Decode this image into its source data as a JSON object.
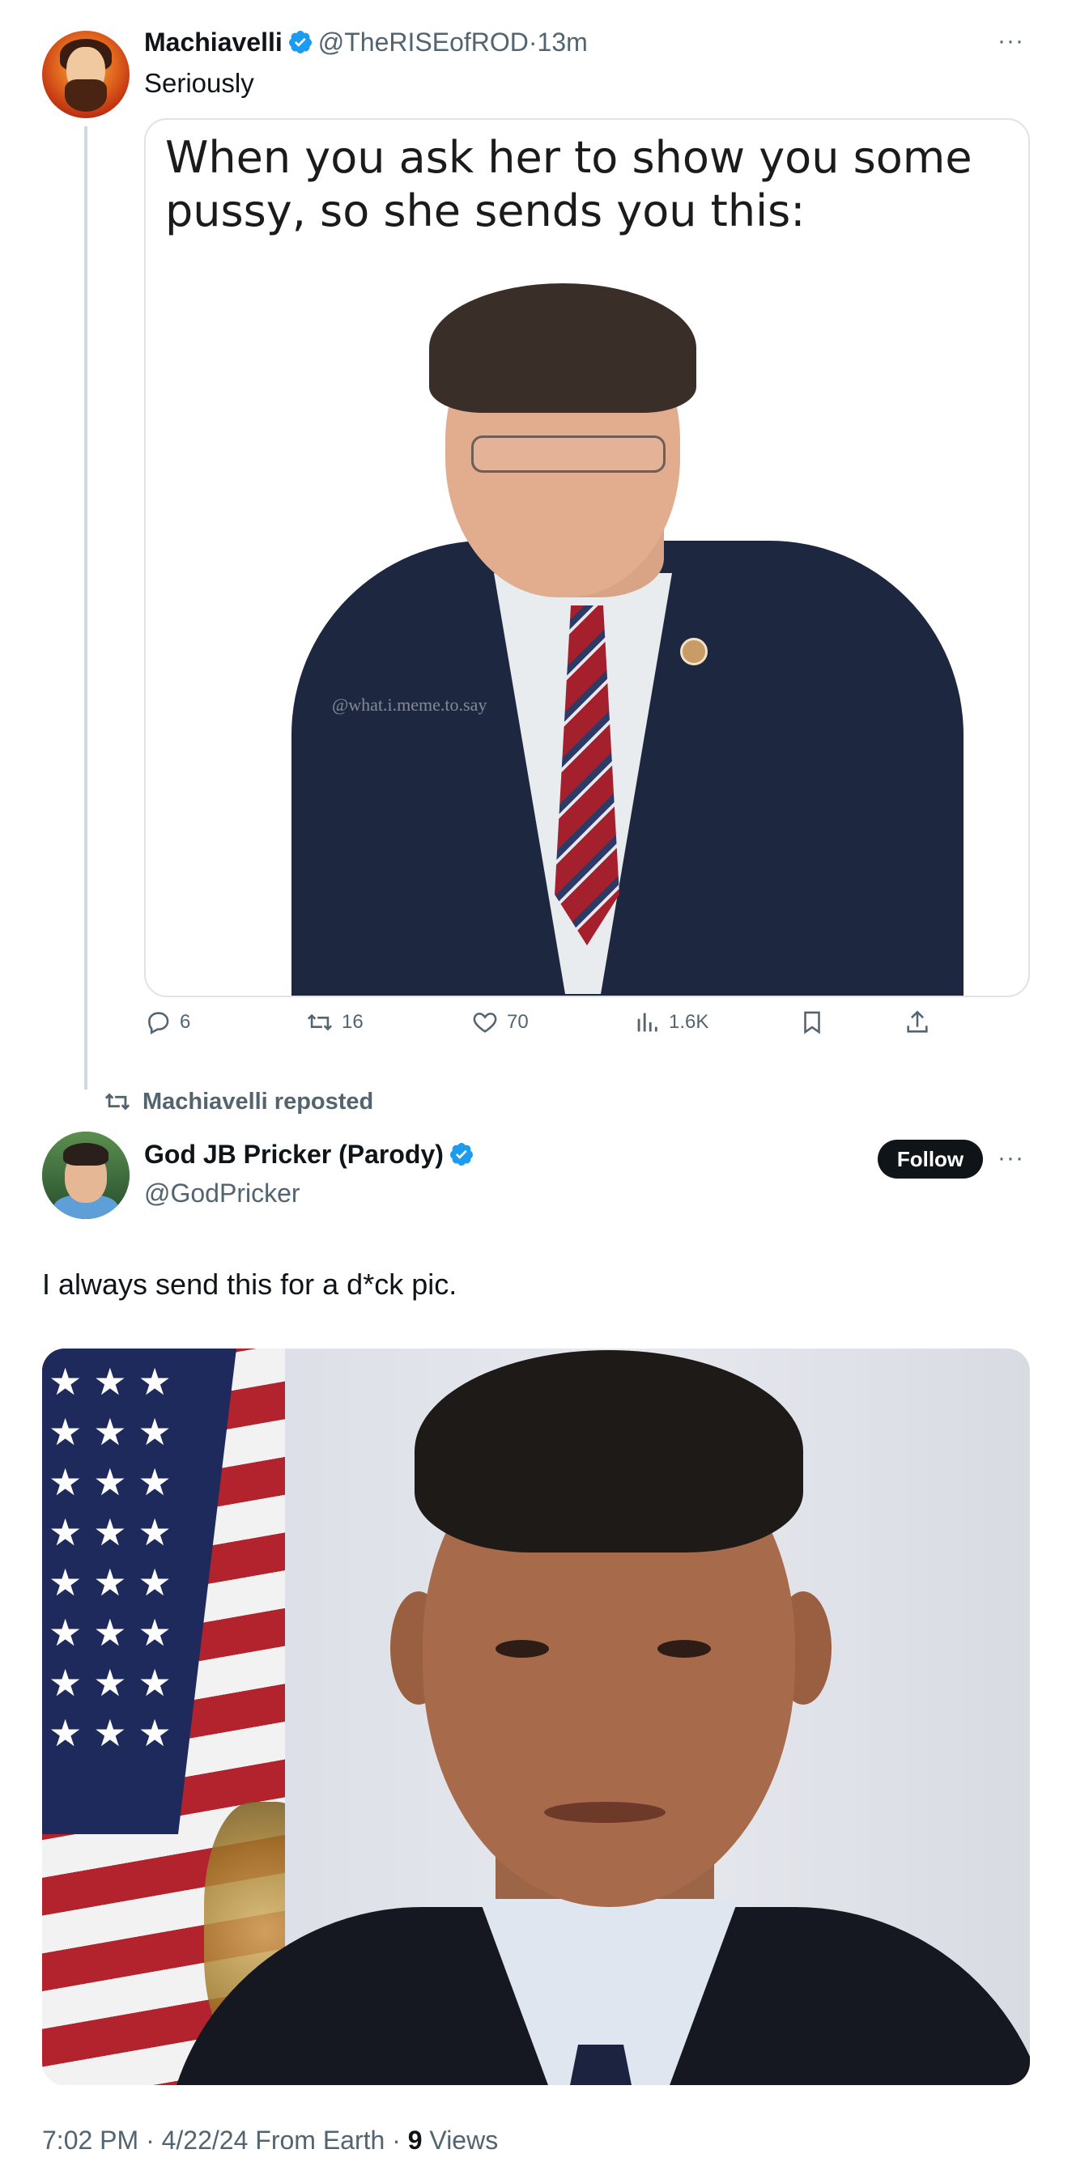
{
  "tweet1": {
    "author_name": "Machiavelli",
    "author_handle": "@TheRISEofROD",
    "time": "13m",
    "text": "Seriously",
    "media_caption": "When you ask her to show you some pussy, so she sends you this:",
    "media_watermark": "@what.i.meme.to.say",
    "actions": {
      "replies": "6",
      "reposts": "16",
      "likes": "70",
      "views": "1.6K"
    }
  },
  "repost_label": "Machiavelli reposted",
  "tweet2": {
    "author_name": "God JB Pricker (Parody)",
    "author_handle": "@GodPricker",
    "follow_label": "Follow",
    "text": "I always send this for a d*ck pic.",
    "time": "7:02 PM",
    "date": "4/22/24",
    "source": "From Earth",
    "views_count": "9",
    "views_label": "Views"
  },
  "colors": {
    "text_primary": "#0f1419",
    "text_secondary": "#536471",
    "verified_blue": "#1d9bf0",
    "border": "#dfe3e6"
  },
  "icons": {
    "verified": "verified-badge-icon",
    "reply": "reply-icon",
    "repost": "repost-icon",
    "like": "heart-icon",
    "views": "views-chart-icon",
    "bookmark": "bookmark-icon",
    "share": "share-icon",
    "more": "more-icon"
  }
}
